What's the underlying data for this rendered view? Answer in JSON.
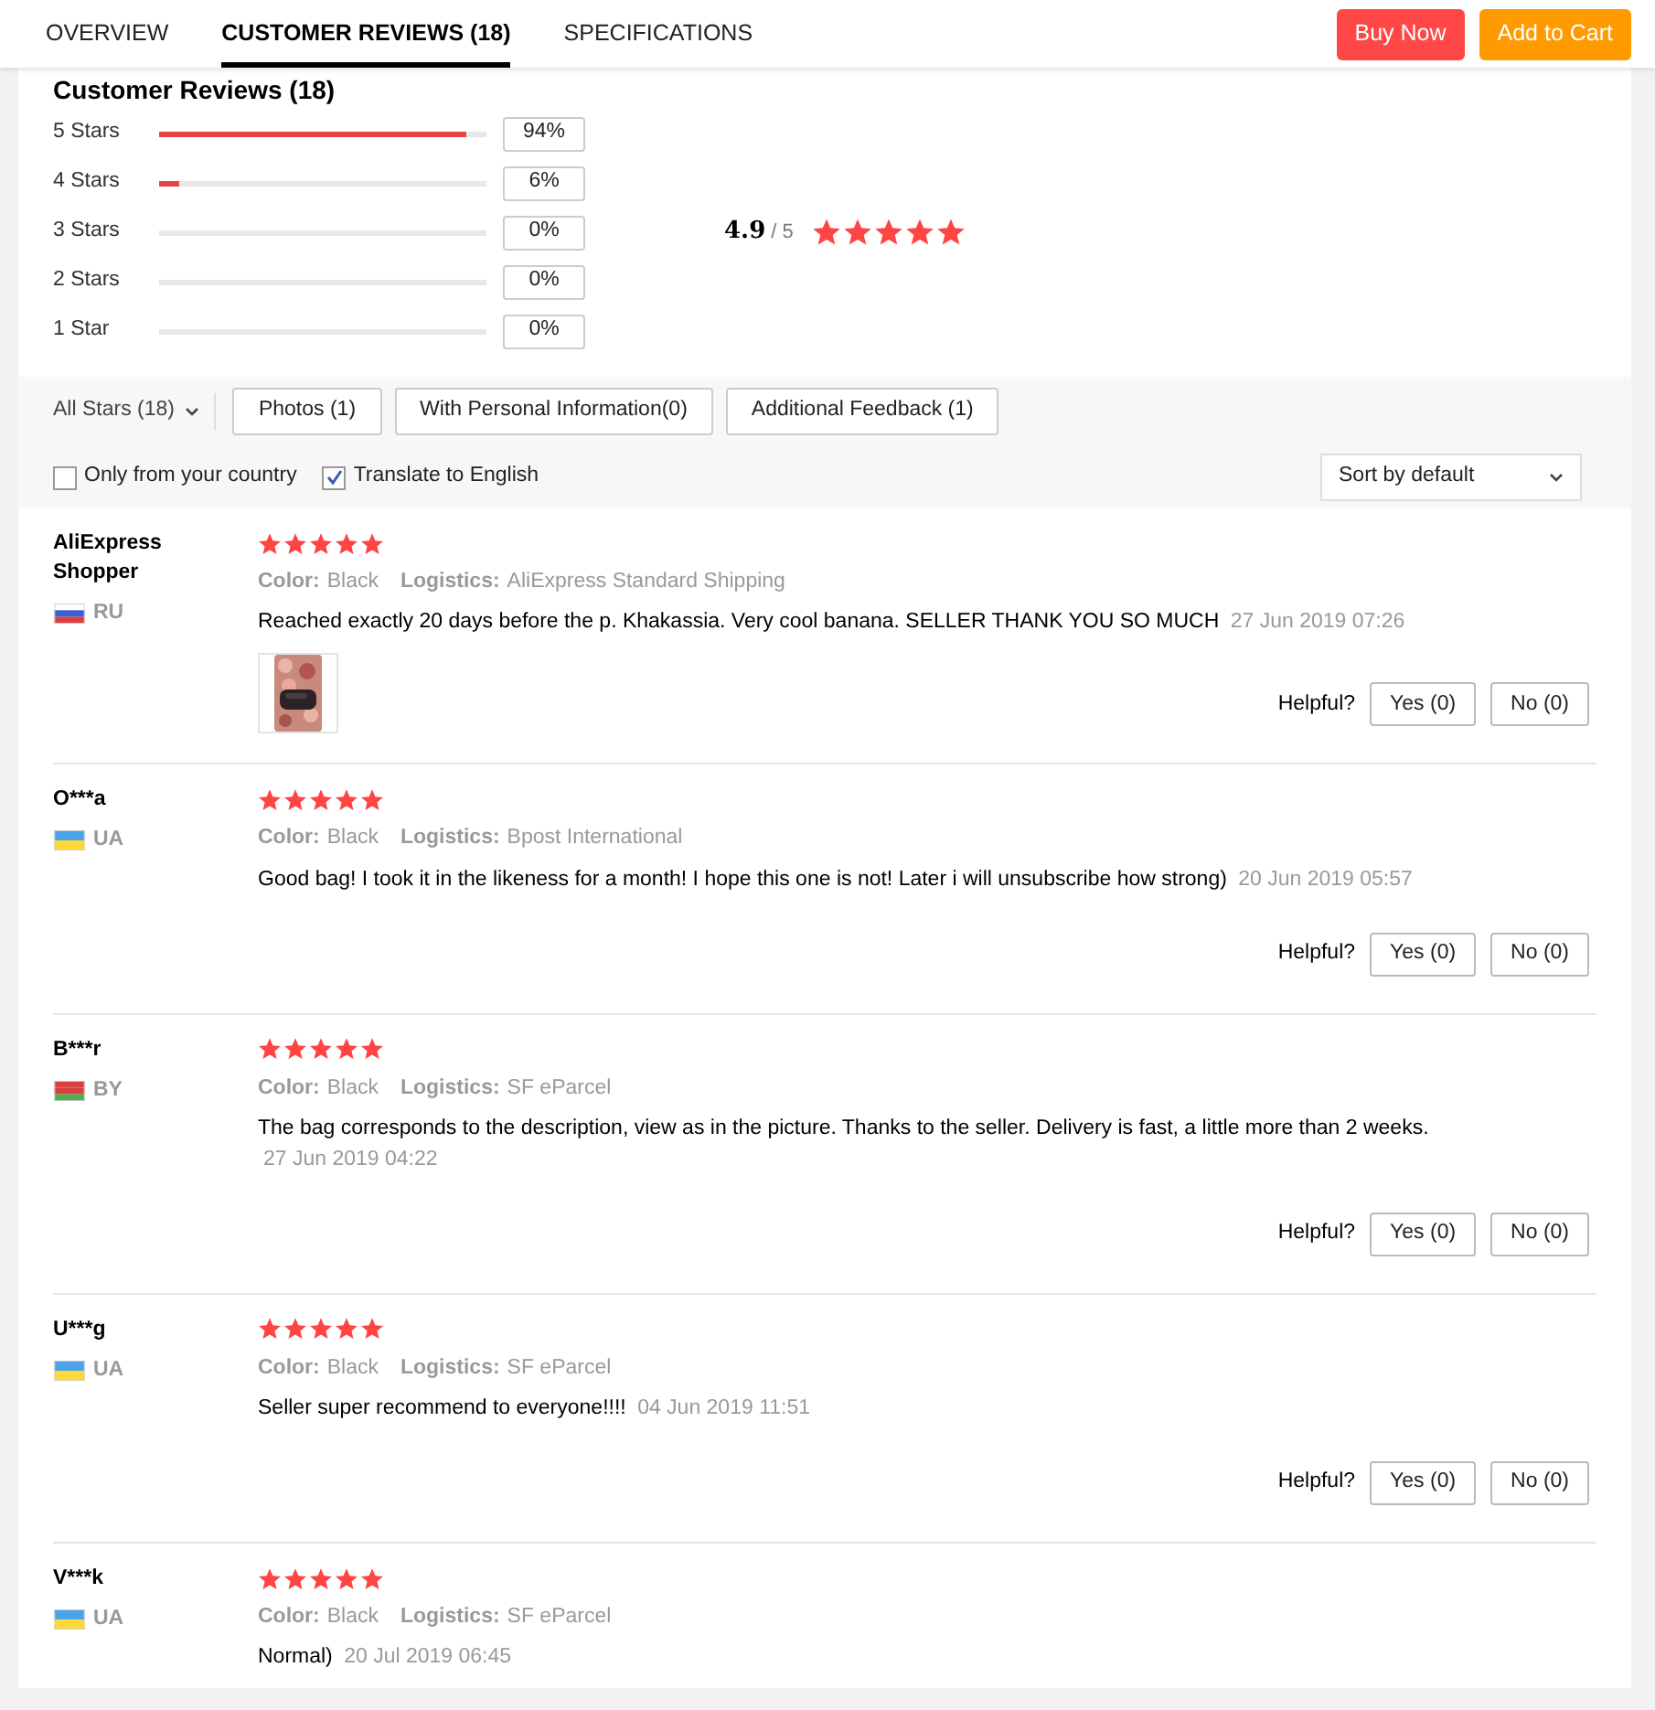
{
  "tabs": [
    {
      "label": "OVERVIEW",
      "selected": false
    },
    {
      "label": "CUSTOMER REVIEWS (18)",
      "selected": true
    },
    {
      "label": "SPECIFICATIONS",
      "selected": false
    }
  ],
  "actions": [
    {
      "label": "Buy Now",
      "kind": "buy"
    },
    {
      "label": "Add to Cart",
      "kind": "cart"
    }
  ],
  "summary": {
    "title": "Customer Reviews (18)",
    "distribution": [
      {
        "label": "5 Stars",
        "level": 0.94,
        "percent": "94%"
      },
      {
        "label": "4 Stars",
        "level": 0.06,
        "percent": "6%"
      },
      {
        "label": "3 Stars",
        "level": 0,
        "percent": "0%"
      },
      {
        "label": "2 Stars",
        "level": 0,
        "percent": "0%"
      },
      {
        "label": "1 Star",
        "level": 0,
        "percent": "0%"
      }
    ],
    "average": "4.9",
    "scale": "/ 5",
    "stars": 5
  },
  "filters": {
    "dropdown": "All Stars (18)",
    "buttons": [
      "Photos (1)",
      "With Personal Information(0)",
      "Additional Feedback (1)"
    ],
    "checkboxes": [
      {
        "label": "Only from your country",
        "checked": false
      },
      {
        "label": "Translate to English",
        "checked": true
      }
    ],
    "sort": "Sort by default"
  },
  "reviews": [
    {
      "name": "AliExpress Shopper",
      "flag": {
        "kind": "ru"
      },
      "country": "RU",
      "stars": 5,
      "attributes": [
        {
          "label": "Color:",
          "value": "Black"
        },
        {
          "label": "Logistics:",
          "value": "AliExpress Standard Shipping"
        }
      ],
      "text": "Reached exactly 20 days before the p. Khakassia. Very cool banana. SELLER THANK YOU SO MUCH",
      "date": "27 Jun 2019 07:26",
      "photos": [
        {
          "kind": "picture"
        }
      ],
      "helpful": "Helpful?",
      "yes": "Yes (0)",
      "no": "No (0)"
    },
    {
      "name": "O***a",
      "flag": {
        "kind": "ua"
      },
      "country": "UA",
      "stars": 5,
      "attributes": [
        {
          "label": "Color:",
          "value": "Black"
        },
        {
          "label": "Logistics:",
          "value": "Bpost International"
        }
      ],
      "text": "Good bag! I took it in the likeness for a month! I hope this one is not! Later i will unsubscribe how strong)",
      "date": "20 Jun 2019 05:57",
      "helpful": "Helpful?",
      "yes": "Yes (0)",
      "no": "No (0)"
    },
    {
      "name": "B***r",
      "flag": {
        "kind": "by"
      },
      "country": "BY",
      "stars": 5,
      "attributes": [
        {
          "label": "Color:",
          "value": "Black"
        },
        {
          "label": "Logistics:",
          "value": "SF eParcel"
        }
      ],
      "text": "The bag corresponds to the description, view as in the picture. Thanks to the seller. Delivery is fast, a little more than 2 weeks.",
      "date": "27 Jun 2019 04:22",
      "helpful": "Helpful?",
      "yes": "Yes (0)",
      "no": "No (0)"
    },
    {
      "name": "U***g",
      "flag": {
        "kind": "ua"
      },
      "country": "UA",
      "stars": 5,
      "attributes": [
        {
          "label": "Color:",
          "value": "Black"
        },
        {
          "label": "Logistics:",
          "value": "SF eParcel"
        }
      ],
      "text": "Seller super recommend to everyone!!!!",
      "date": "04 Jun 2019 11:51",
      "helpful": "Helpful?",
      "yes": "Yes (0)",
      "no": "No (0)"
    },
    {
      "name": "V***k",
      "flag": {
        "kind": "ua"
      },
      "country": "UA",
      "stars": 5,
      "attributes": [
        {
          "label": "Color:",
          "value": "Black"
        },
        {
          "label": "Logistics:",
          "value": "SF eParcel"
        }
      ],
      "text": "Normal)",
      "date": "20 Jul 2019 06:45"
    }
  ]
}
